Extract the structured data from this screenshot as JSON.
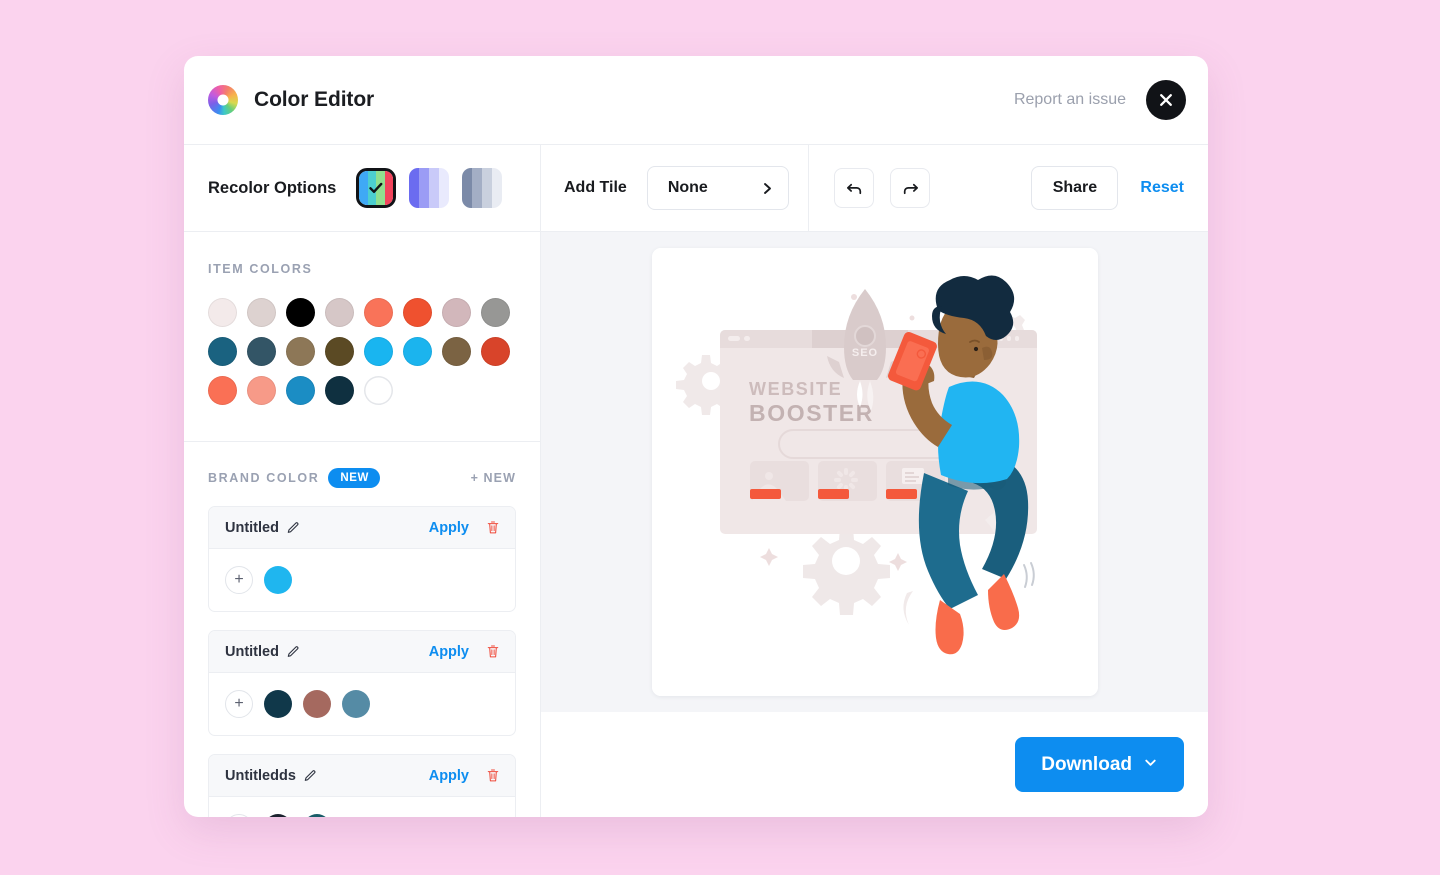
{
  "header": {
    "logo_icon": "color-wheel-icon",
    "title": "Color Editor",
    "report_link": "Report an issue",
    "close_icon": "close-icon"
  },
  "toolbar": {
    "recolor_label": "Recolor Options",
    "recolor_options": [
      {
        "name": "rainbow-palette",
        "selected": true,
        "colors": [
          "#3fa9f5",
          "#4ccfd0",
          "#90e08f",
          "#f2445c"
        ]
      },
      {
        "name": "blue-gradient-palette",
        "selected": false,
        "colors": [
          "#6b6cf0",
          "#9b9cf5",
          "#c9caf9",
          "#e9eafd"
        ]
      },
      {
        "name": "slate-gradient-palette",
        "selected": false,
        "colors": [
          "#7b8aa8",
          "#a3aec5",
          "#c9d0de",
          "#e9ecf3"
        ]
      }
    ],
    "add_tile_label": "Add Tile",
    "add_tile_value": "None",
    "add_tile_chevron": "chevron-right-icon",
    "undo_icon": "undo-arrow-icon",
    "redo_icon": "redo-arrow-icon",
    "share_label": "Share",
    "reset_label": "Reset",
    "accent_color": "#0d8df0"
  },
  "item_colors": {
    "title": "ITEM COLORS",
    "swatches": [
      "#f3eaea",
      "#ddd2d0",
      "#000000",
      "#d6c7c7",
      "#f97359",
      "#ef512f",
      "#d2b7bb",
      "#979795",
      "#1a6280",
      "#335566",
      "#8d7757",
      "#5b4a24",
      "#19b5f0",
      "#1bb4ee",
      "#7b6343",
      "#d8442a",
      "#fa7055",
      "#f79a88",
      "#1b8dc4",
      "#0f3040",
      "#ffffff"
    ]
  },
  "brand_color": {
    "title": "BRAND COLOR",
    "badge": "NEW",
    "add_new_label": "+ NEW",
    "edit_icon": "pencil-icon",
    "delete_icon": "trash-icon",
    "add_swatch_icon": "plus-icon",
    "apply_label": "Apply",
    "palettes": [
      {
        "name": "Untitled",
        "colors": [
          "#1fb6ef"
        ]
      },
      {
        "name": "Untitled",
        "colors": [
          "#10384a",
          "#a5695f",
          "#558ba5"
        ]
      },
      {
        "name": "Untitledds",
        "colors": [
          "#1b222e",
          "#195c68"
        ]
      }
    ]
  },
  "canvas": {
    "artwork_name": "website-booster-illustration",
    "artwork_text": {
      "heading_line1": "WEBSITE",
      "heading_line2": "BOOSTER",
      "rocket_label": "SEO"
    }
  },
  "footer": {
    "download_label": "Download",
    "download_chevron": "chevron-down-icon"
  }
}
